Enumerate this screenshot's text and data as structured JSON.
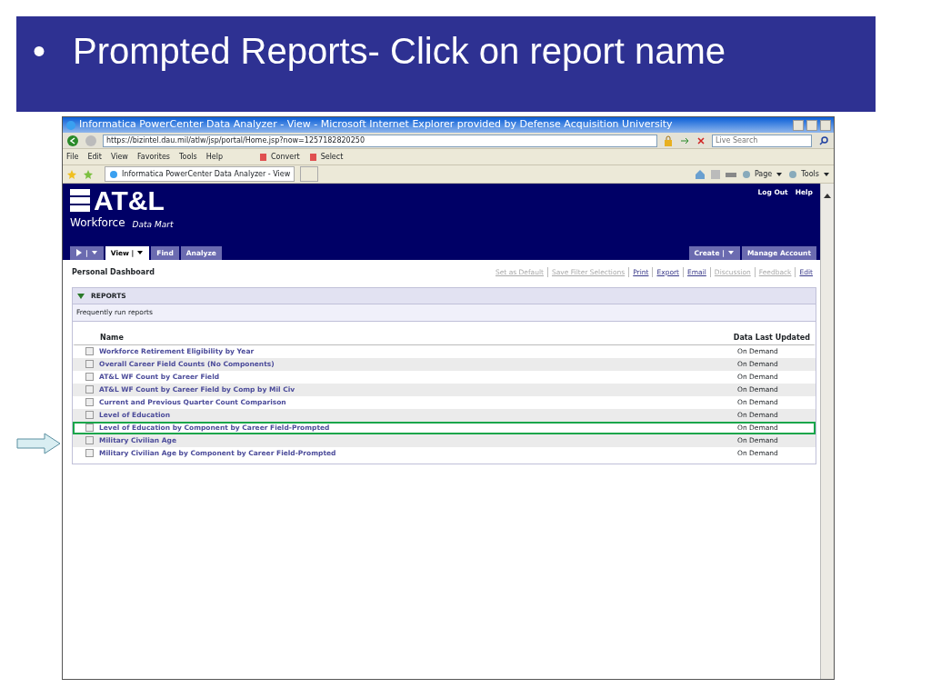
{
  "slide": {
    "bullet": "•",
    "title": "Prompted Reports- Click on report name"
  },
  "browser": {
    "title": "Informatica PowerCenter Data Analyzer - View - Microsoft Internet Explorer provided by Defense Acquisition University",
    "address": "https://bizintel.dau.mil/atlw/jsp/portal/Home.jsp?now=1257182820250",
    "search_placeholder": "Live Search",
    "menu": [
      "File",
      "Edit",
      "View",
      "Favorites",
      "Tools",
      "Help"
    ],
    "menu_extras": [
      "Convert",
      "Select"
    ],
    "tab": "Informatica PowerCenter Data Analyzer - View",
    "command_bar": [
      "Page",
      "Tools"
    ]
  },
  "app": {
    "logo": {
      "main": "AT&L",
      "sub": "Workforce",
      "tagline": "Data Mart"
    },
    "top_links": [
      "Log Out",
      "Help"
    ],
    "nav_tabs": [
      {
        "kind": "icon",
        "label": "|",
        "selected": false,
        "dropdown": true
      },
      {
        "kind": "text",
        "label": "View |",
        "selected": true,
        "dropdown": true
      },
      {
        "kind": "text",
        "label": "Find",
        "selected": false,
        "dropdown": false
      },
      {
        "kind": "text",
        "label": "Analyze",
        "selected": false,
        "dropdown": false
      }
    ],
    "right_tabs": [
      {
        "label": "Create |",
        "dropdown": true
      },
      {
        "label": "Manage Account",
        "dropdown": false
      }
    ],
    "page_title": "Personal Dashboard",
    "actions": [
      {
        "label": "Set as Default",
        "disabled": true
      },
      {
        "label": "Save Filter Selections",
        "disabled": true
      },
      {
        "label": "Print",
        "disabled": false
      },
      {
        "label": "Export",
        "disabled": false
      },
      {
        "label": "Email",
        "disabled": false
      },
      {
        "label": "Discussion",
        "disabled": true
      },
      {
        "label": "Feedback",
        "disabled": true
      },
      {
        "label": "Edit",
        "disabled": false
      }
    ],
    "section": {
      "title": "REPORTS",
      "expanded": true,
      "subtitle": "Frequently run reports",
      "columns": [
        "Name",
        "Data Last Updated"
      ],
      "rows": [
        {
          "name": "Workforce Retirement Eligibility by Year",
          "updated": "On Demand",
          "highlighted": false
        },
        {
          "name": "Overall Career Field Counts (No Components)",
          "updated": "On Demand",
          "highlighted": false
        },
        {
          "name": "AT&L WF Count by Career Field",
          "updated": "On Demand",
          "highlighted": false
        },
        {
          "name": "AT&L WF Count by Career Field by Comp by Mil Civ",
          "updated": "On Demand",
          "highlighted": false
        },
        {
          "name": "Current and Previous Quarter Count Comparison",
          "updated": "On Demand",
          "highlighted": false
        },
        {
          "name": "Level of Education",
          "updated": "On Demand",
          "highlighted": false
        },
        {
          "name": "Level of Education by Component by Career Field-Prompted",
          "updated": "On Demand",
          "highlighted": true
        },
        {
          "name": "Military Civilian Age",
          "updated": "On Demand",
          "highlighted": false
        },
        {
          "name": "Military Civilian Age by Component by Career Field-Prompted",
          "updated": "On Demand",
          "highlighted": false
        }
      ]
    }
  }
}
